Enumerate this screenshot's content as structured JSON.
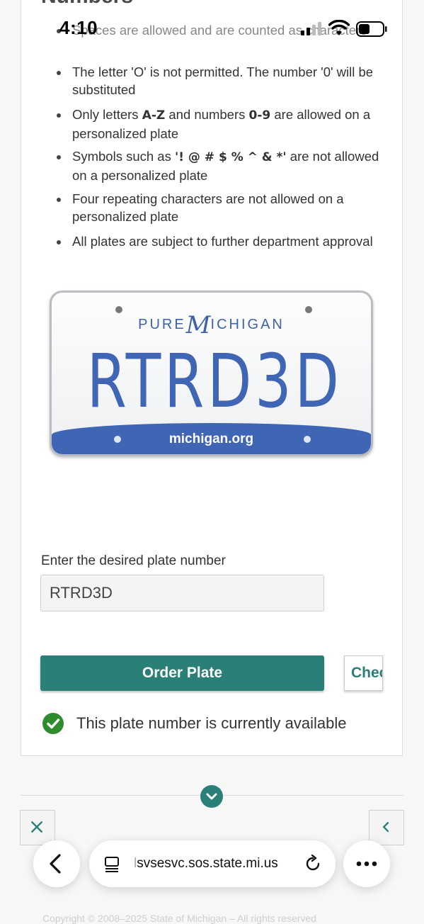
{
  "status_bar": {
    "time": "4:10"
  },
  "page": {
    "heading_partial": "Numbers",
    "rules": [
      {
        "text": "Spaces are allowed and are counted as characters"
      },
      {
        "text": "The letter 'O' is not permitted. The number '0' will be substituted"
      },
      {
        "pre": "Only letters ",
        "b1": "A-Z",
        "mid": " and numbers ",
        "b2": "0-9",
        "post": " are allowed on a personalized plate"
      },
      {
        "pre": "Symbols such as ",
        "b1": "'! @ # $ % ^ & *'",
        "post": " are not allowed on a personalized plate"
      },
      {
        "text": "Four repeating characters are not allowed on a personalized plate"
      },
      {
        "text": "All plates are subject to further department approval"
      }
    ],
    "plate": {
      "tagline_left": "PURE",
      "tagline_m": "M",
      "tagline_right": "ICHIGAN",
      "number": "RTRD3D",
      "footer": "michigan.org",
      "number_color": "#3f65b5"
    },
    "form": {
      "label": "Enter the desired plate number",
      "value": "RTRD3D",
      "order_button": "Order Plate",
      "check_button": "Check"
    },
    "availability": {
      "icon": "check-circle-icon",
      "text": "This plate number is currently available",
      "color": "#2e8b2e"
    },
    "footer_faded": "Copyright © 2008–2025 State of Michigan – All rights reserved"
  },
  "browser": {
    "url_faded": "l",
    "url": "svsesvc.sos.state.mi.us",
    "accent": "#2a7f76"
  }
}
